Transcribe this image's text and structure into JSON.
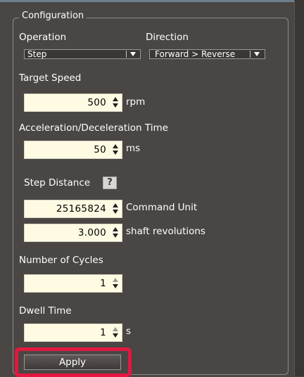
{
  "group": {
    "title": "Configuration"
  },
  "operation": {
    "label": "Operation",
    "selected": "Step"
  },
  "direction": {
    "label": "Direction",
    "selected": "Forward > Reverse"
  },
  "target_speed": {
    "label": "Target Speed",
    "value": "500",
    "unit": "rpm"
  },
  "accel_decel_time": {
    "label": "Acceleration/Deceleration Time",
    "value": "50",
    "unit": "ms"
  },
  "step_distance": {
    "label": "Step Distance",
    "help_glyph": "?",
    "command_value": "25165824",
    "command_unit": "Command Unit",
    "revolutions_value": "3.000",
    "revolutions_unit": "shaft revolutions"
  },
  "number_of_cycles": {
    "label": "Number of Cycles",
    "value": "1"
  },
  "dwell_time": {
    "label": "Dwell Time",
    "value": "1",
    "unit": "s"
  },
  "apply_button": {
    "label": "Apply"
  },
  "colors": {
    "panel_bg": "#4a4644",
    "field_bg": "#fffbe3",
    "highlight": "#e3173f"
  }
}
